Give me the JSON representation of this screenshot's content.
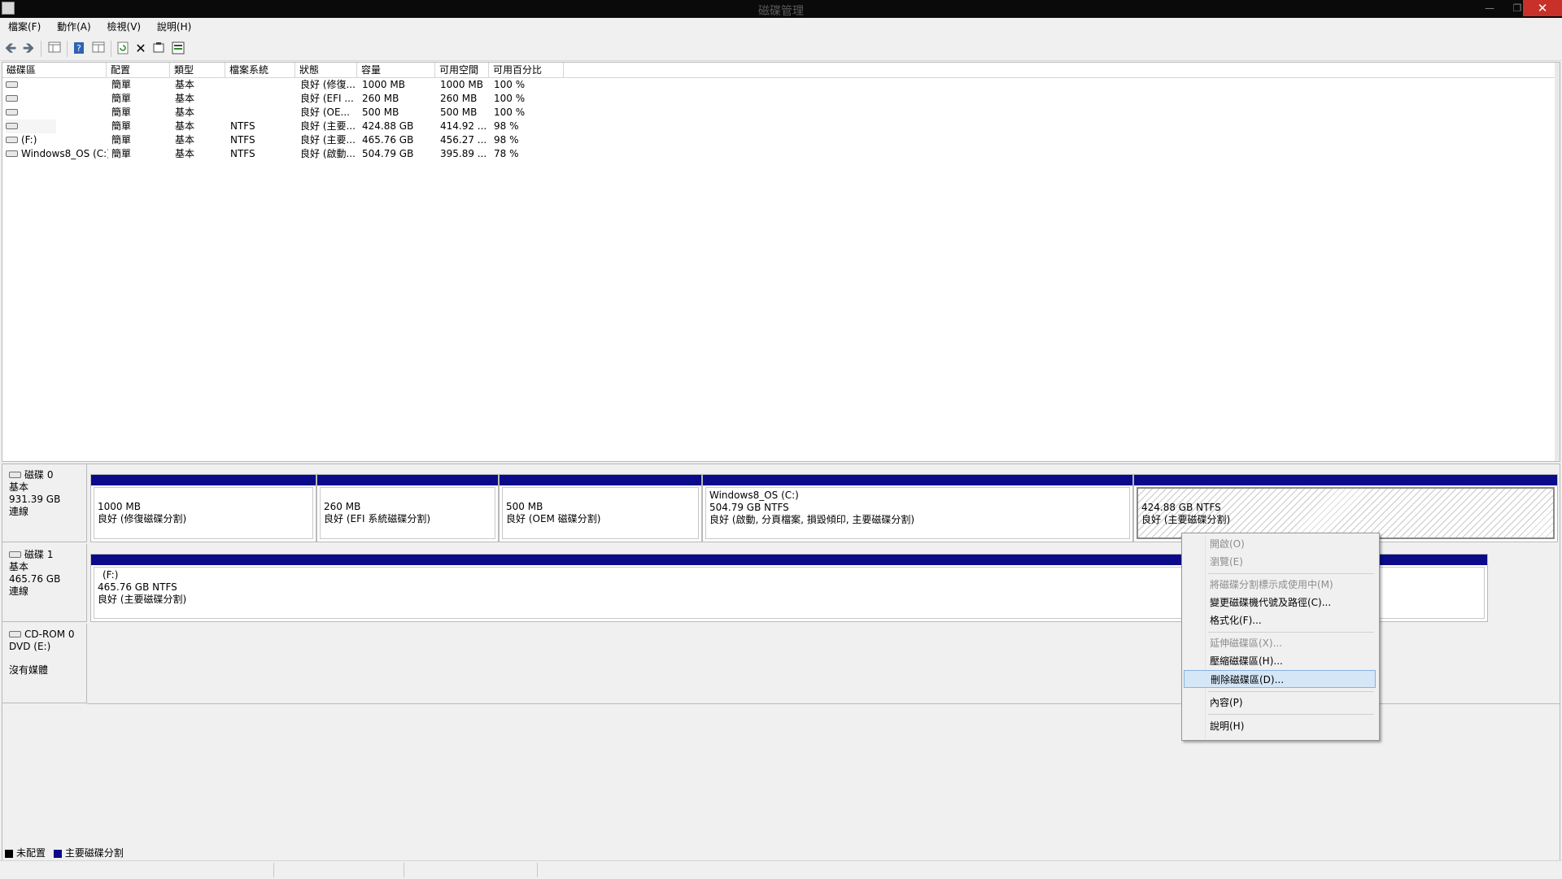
{
  "window": {
    "title": "磁碟管理"
  },
  "menubar": [
    "檔案(F)",
    "動作(A)",
    "檢視(V)",
    "說明(H)"
  ],
  "list": {
    "columns": [
      "磁碟區",
      "配置",
      "類型",
      "檔案系統",
      "狀態",
      "容量",
      "可用空間",
      "可用百分比"
    ],
    "rows": [
      {
        "vol": "",
        "layout": "簡單",
        "type": "基本",
        "fs": "",
        "status": "良好 (修復...",
        "cap": "1000 MB",
        "free": "1000 MB",
        "pct": "100 %"
      },
      {
        "vol": "",
        "layout": "簡單",
        "type": "基本",
        "fs": "",
        "status": "良好 (EFI ...",
        "cap": "260 MB",
        "free": "260 MB",
        "pct": "100 %"
      },
      {
        "vol": "",
        "layout": "簡單",
        "type": "基本",
        "fs": "",
        "status": "良好 (OE...",
        "cap": "500 MB",
        "free": "500 MB",
        "pct": "100 %"
      },
      {
        "vol": "",
        "layout": "簡單",
        "type": "基本",
        "fs": "NTFS",
        "status": "良好 (主要...",
        "cap": "424.88 GB",
        "free": "414.92 ...",
        "pct": "98 %"
      },
      {
        "vol": "(F:)",
        "layout": "簡單",
        "type": "基本",
        "fs": "NTFS",
        "status": "良好 (主要...",
        "cap": "465.76 GB",
        "free": "456.27 ...",
        "pct": "98 %"
      },
      {
        "vol": "Windows8_OS (C:)",
        "layout": "簡單",
        "type": "基本",
        "fs": "NTFS",
        "status": "良好 (啟動...",
        "cap": "504.79 GB",
        "free": "395.89 ...",
        "pct": "78 %"
      }
    ]
  },
  "disks": [
    {
      "name": "磁碟 0",
      "type": "基本",
      "size": "931.39 GB",
      "status": "連線",
      "partitions": [
        {
          "title": "",
          "line1": "1000 MB",
          "line2": "良好 (修復磁碟分割)"
        },
        {
          "title": "",
          "line1": "260 MB",
          "line2": "良好 (EFI 系統磁碟分割)"
        },
        {
          "title": "",
          "line1": "500 MB",
          "line2": "良好 (OEM 磁碟分割)"
        },
        {
          "title": "Windows8_OS  (C:)",
          "line1": "504.79 GB NTFS",
          "line2": "良好 (啟動, 分頁檔案, 損毀傾印, 主要磁碟分割)"
        },
        {
          "title": "",
          "line1": "424.88 GB NTFS",
          "line2": "良好 (主要磁碟分割)"
        }
      ]
    },
    {
      "name": "磁碟 1",
      "type": "基本",
      "size": "465.76 GB",
      "status": "連線",
      "partitions": [
        {
          "title": "(F:)",
          "line1": "465.76 GB NTFS",
          "line2": "良好 (主要磁碟分割)"
        }
      ]
    },
    {
      "name": "CD-ROM 0",
      "type": "DVD (E:)",
      "size": "",
      "status": "沒有媒體"
    }
  ],
  "legend": [
    {
      "label": "未配置",
      "color": "#000000"
    },
    {
      "label": "主要磁碟分割",
      "color": "#0a0a8a"
    }
  ],
  "context_menu": {
    "items": [
      {
        "label": "開啟(O)",
        "enabled": false
      },
      {
        "label": "瀏覽(E)",
        "enabled": false
      },
      {
        "label": "將磁碟分割標示成使用中(M)",
        "enabled": false
      },
      {
        "label": "變更磁碟機代號及路徑(C)...",
        "enabled": true
      },
      {
        "label": "格式化(F)...",
        "enabled": true
      },
      {
        "label": "延伸磁碟區(X)...",
        "enabled": false
      },
      {
        "label": "壓縮磁碟區(H)...",
        "enabled": true
      },
      {
        "label": "刪除磁碟區(D)...",
        "enabled": true,
        "highlighted": true
      },
      {
        "label": "內容(P)",
        "enabled": true
      },
      {
        "label": "說明(H)",
        "enabled": true
      }
    ]
  },
  "icons": [
    "back-arrow-icon",
    "forward-arrow-icon",
    "console-tree-icon",
    "help-icon",
    "list-view-icon",
    "refresh-icon",
    "delete-icon",
    "properties-icon",
    "rescan-icon"
  ]
}
